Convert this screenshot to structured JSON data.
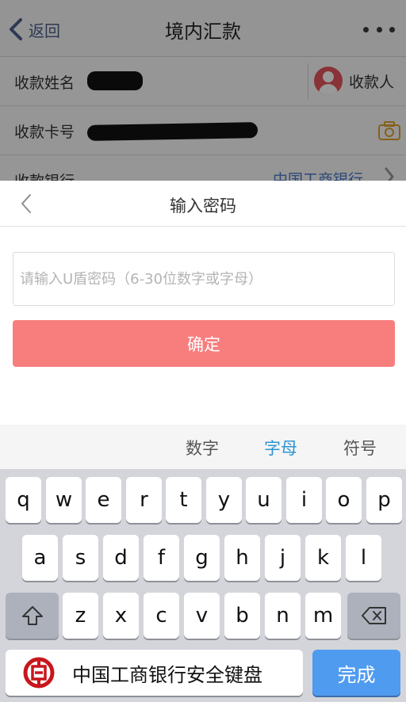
{
  "nav": {
    "back_label": "返回",
    "title": "境内汇款"
  },
  "form": {
    "payee_name_label": "收款姓名",
    "payee_button_label": "收款人",
    "card_label": "收款卡号",
    "bank_label": "收款银行",
    "bank_value": "中国工商银行"
  },
  "dialog": {
    "title": "输入密码",
    "password_placeholder": "请输入U盾密码（6-30位数字或字母）",
    "password_value": "",
    "confirm_label": "确定"
  },
  "keyboard": {
    "tabs": [
      "数字",
      "字母",
      "符号"
    ],
    "active_tab": "字母",
    "row1": [
      "q",
      "w",
      "e",
      "r",
      "t",
      "y",
      "u",
      "i",
      "o",
      "p"
    ],
    "row2": [
      "a",
      "s",
      "d",
      "f",
      "g",
      "h",
      "j",
      "k",
      "l"
    ],
    "row3": [
      "z",
      "x",
      "c",
      "v",
      "b",
      "n",
      "m"
    ],
    "shift_icon": "shift-icon",
    "delete_icon": "backspace-icon",
    "brand_label": "中国工商银行安全键盘",
    "done_label": "完成"
  },
  "colors": {
    "confirm_button": "#f87e7e",
    "active_tab": "#2e95d3",
    "done_key": "#4f9bf0",
    "icbc_red": "#c8161d",
    "avatar": "#e4545d"
  }
}
